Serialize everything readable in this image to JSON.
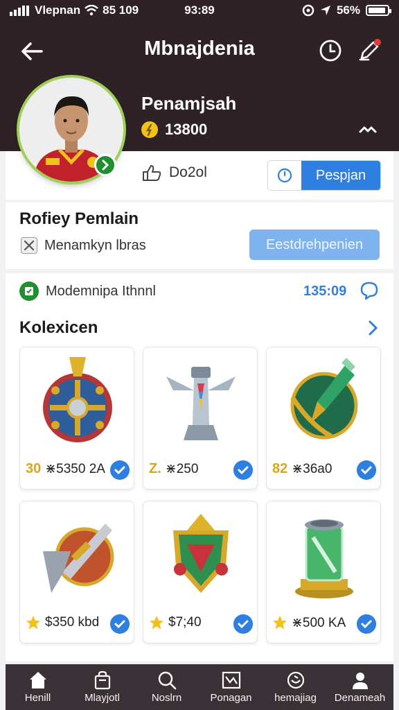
{
  "status_bar": {
    "carrier": "Vlepnan",
    "network": "85 109",
    "time": "93:89",
    "battery": "56%"
  },
  "header": {
    "title": "Mbnajdenia"
  },
  "profile": {
    "name": "Penamjsah",
    "coins": "13800",
    "stat_label": "Do2ol",
    "action_button": "Pespjan"
  },
  "profile_card": {
    "title": "Rofiey Pemlain",
    "tag": "Menamkyn lbras",
    "button": "Eestdrehpenien"
  },
  "mode": {
    "label": "Modemnipa Ithnnl",
    "value": "135:09"
  },
  "collection": {
    "title": "Kolexicen",
    "items": [
      {
        "level": "30",
        "price": "⋇5350 2A",
        "star": false,
        "art": "shield"
      },
      {
        "level": "Z.",
        "price": "⋇250",
        "star": false,
        "art": "tower"
      },
      {
        "level": "82",
        "price": "⋇36a0",
        "star": false,
        "art": "arrow"
      },
      {
        "level": "",
        "price": "$350 kbd",
        "star": true,
        "art": "blade"
      },
      {
        "level": "",
        "price": "$7;40",
        "star": true,
        "art": "emblem"
      },
      {
        "level": "",
        "price": "⋇500 KA",
        "star": true,
        "art": "canister"
      }
    ]
  },
  "bottom_nav": [
    {
      "label": "Henill",
      "icon": "home-icon"
    },
    {
      "label": "Mlayjotl",
      "icon": "bag-icon"
    },
    {
      "label": "Noslrn",
      "icon": "search-icon"
    },
    {
      "label": "Ponagan",
      "icon": "mail-icon"
    },
    {
      "label": "hemajiag",
      "icon": "smile-icon"
    },
    {
      "label": "Denameah",
      "icon": "user-icon"
    }
  ],
  "colors": {
    "header_bg": "#2f2226",
    "accent_blue": "#2f7fe0",
    "light_blue": "#7fb3ef",
    "gold": "#d9a51c",
    "green": "#1f8f2f"
  }
}
